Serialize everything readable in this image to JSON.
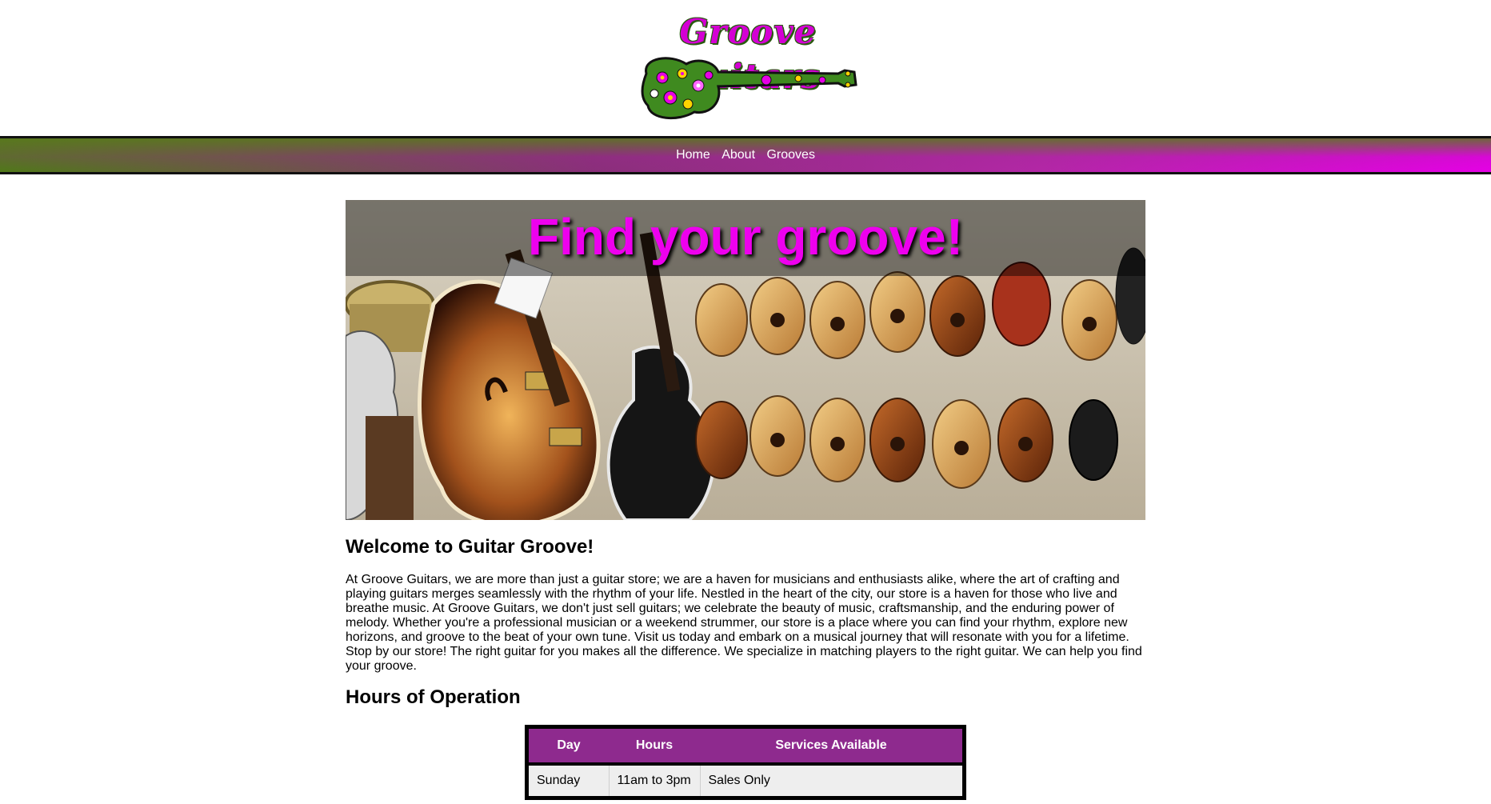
{
  "brand": {
    "name": "Groove Guitars"
  },
  "nav": {
    "items": [
      "Home",
      "About",
      "Grooves"
    ]
  },
  "hero": {
    "title": "Find your groove!"
  },
  "welcome": {
    "heading": "Welcome to Guitar Groove!",
    "body": "At Groove Guitars, we are more than just a guitar store; we are a haven for musicians and enthusiasts alike, where the art of crafting and playing guitars merges seamlessly with the rhythm of your life. Nestled in the heart of the city, our store is a haven for those who live and breathe music. At Groove Guitars, we don't just sell guitars; we celebrate the beauty of music, craftsmanship, and the enduring power of melody. Whether you're a professional musician or a weekend strummer, our store is a place where you can find your rhythm, explore new horizons, and groove to the beat of your own tune. Visit us today and embark on a musical journey that will resonate with you for a lifetime. Stop by our store! The right guitar for you makes all the difference. We specialize in matching players to the right guitar. We can help you find your groove."
  },
  "hours": {
    "heading": "Hours of Operation",
    "columns": [
      "Day",
      "Hours",
      "Services Available"
    ],
    "rows": [
      [
        "Sunday",
        "11am to 3pm",
        "Sales Only"
      ]
    ]
  },
  "colors": {
    "accent": "#ee00ee",
    "table_header": "#8e2a8e",
    "nav_green": "#4f7a17"
  },
  "icons": {
    "logo": "guitar-logo-icon"
  }
}
